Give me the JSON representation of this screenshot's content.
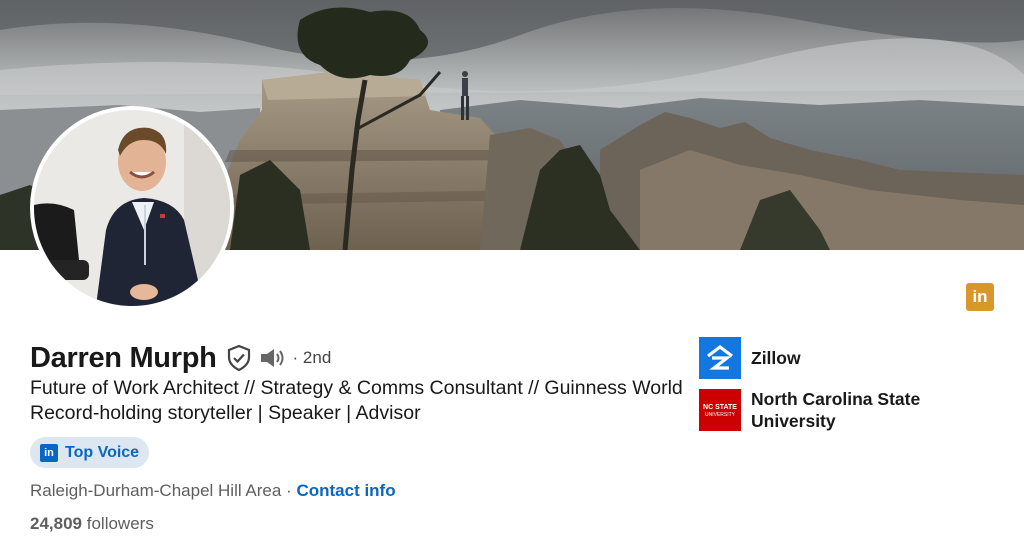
{
  "profile": {
    "name": "Darren Murph",
    "degree": "· 2nd",
    "headline": "Future of Work Architect // Strategy & Comms Consultant // Guinness World Record-holding storyteller | Speaker | Advisor",
    "badge_label": "Top Voice",
    "location": "Raleigh-Durham-Chapel Hill Area ·",
    "contact_label": "Contact info",
    "followers_count": "24,809",
    "followers_label": "followers"
  },
  "experience": [
    {
      "company": "Zillow"
    },
    {
      "company": "North Carolina State University"
    }
  ],
  "logos": {
    "linkedin_glyph": "in",
    "ncstate_line1": "NC STATE",
    "ncstate_line2": "UNIVERSITY"
  },
  "colors": {
    "linkedin_blue": "#0a66c2",
    "zillow_blue": "#1277e1",
    "ncstate_red": "#cc0000",
    "linkedin_gold": "#d8962b"
  }
}
